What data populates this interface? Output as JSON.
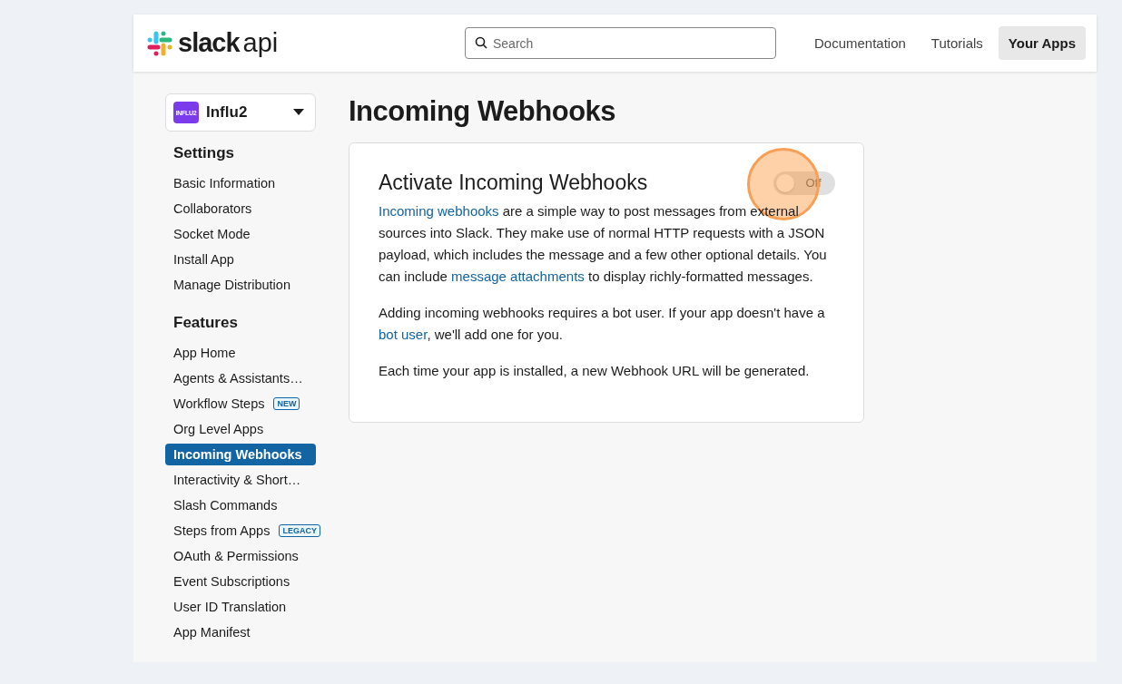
{
  "header": {
    "logo": {
      "word": "slack",
      "suffix": "api"
    },
    "search": {
      "placeholder": "Search"
    },
    "nav": [
      {
        "label": "Documentation",
        "selected": false
      },
      {
        "label": "Tutorials",
        "selected": false
      },
      {
        "label": "Your Apps",
        "selected": true
      }
    ]
  },
  "app_picker": {
    "icon_text": "INFLU2",
    "name": "Influ2"
  },
  "sidebar": {
    "sections": [
      {
        "heading": "Settings",
        "items": [
          {
            "label": "Basic Information",
            "selected": false
          },
          {
            "label": "Collaborators",
            "selected": false
          },
          {
            "label": "Socket Mode",
            "selected": false
          },
          {
            "label": "Install App",
            "selected": false
          },
          {
            "label": "Manage Distribution",
            "selected": false
          }
        ]
      },
      {
        "heading": "Features",
        "items": [
          {
            "label": "App Home",
            "selected": false
          },
          {
            "label": "Agents & Assistants…",
            "selected": false
          },
          {
            "label": "Workflow Steps",
            "selected": false,
            "badge": "NEW"
          },
          {
            "label": "Org Level Apps",
            "selected": false
          },
          {
            "label": "Incoming Webhooks",
            "selected": true
          },
          {
            "label": "Interactivity & Short…",
            "selected": false
          },
          {
            "label": "Slash Commands",
            "selected": false
          },
          {
            "label": "Steps from Apps",
            "selected": false,
            "badge": "LEGACY"
          },
          {
            "label": "OAuth & Permissions",
            "selected": false
          },
          {
            "label": "Event Subscriptions",
            "selected": false
          },
          {
            "label": "User ID Translation",
            "selected": false
          },
          {
            "label": "App Manifest",
            "selected": false
          }
        ]
      }
    ]
  },
  "page_title": "Incoming Webhooks",
  "card": {
    "title": "Activate Incoming Webhooks",
    "toggle": {
      "label": "Off",
      "on": false
    },
    "click_highlight": true,
    "paragraphs": [
      [
        {
          "text": "Incoming webhooks",
          "kind": "link"
        },
        {
          "text": " are a simple way to post messages from external sources into Slack. They make use of normal HTTP requests with a JSON payload, which includes the message and a few other optional details. You can include ",
          "kind": "plain"
        },
        {
          "text": "message attachments",
          "kind": "link"
        },
        {
          "text": " to display richly-formatted messages.",
          "kind": "plain"
        }
      ],
      [
        {
          "text": "Adding incoming webhooks requires a bot user. If your app doesn't have a ",
          "kind": "plain"
        },
        {
          "text": "bot user",
          "kind": "link"
        },
        {
          "text": ", we'll add one for you.",
          "kind": "plain"
        }
      ],
      [
        {
          "text": "Each time your app is installed, a new Webhook URL will be generated.",
          "kind": "plain"
        }
      ]
    ]
  }
}
